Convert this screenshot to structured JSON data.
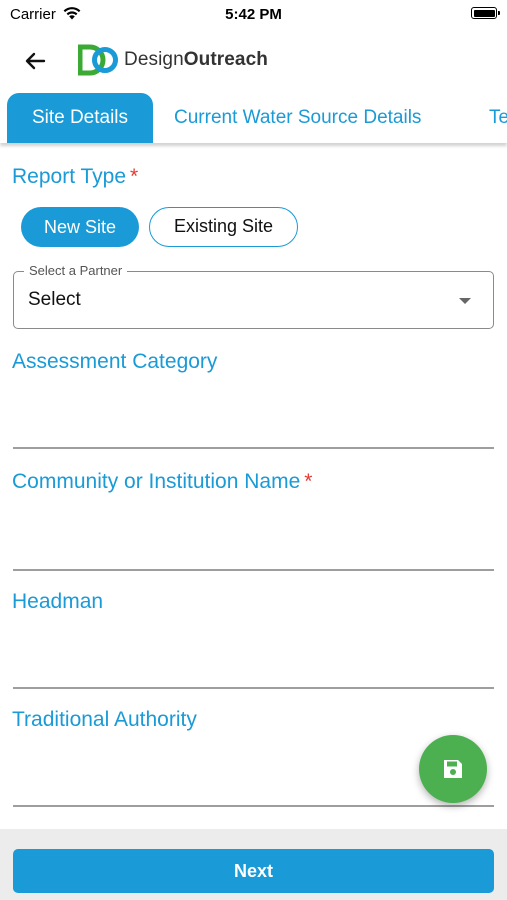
{
  "status_bar": {
    "carrier": "Carrier",
    "time": "5:42 PM"
  },
  "app_bar": {
    "brand_prefix": "Design",
    "brand_suffix": "Outreach",
    "logo_letters": "DO"
  },
  "tabs": [
    {
      "label": "Site Details",
      "active": true
    },
    {
      "label": "Current Water Source Details",
      "active": false
    },
    {
      "label": "Te",
      "active": false
    }
  ],
  "form": {
    "report_type": {
      "label": "Report Type",
      "required_mark": "*",
      "options": [
        "New Site",
        "Existing Site"
      ],
      "selected": "New Site"
    },
    "partner": {
      "legend": "Select a Partner",
      "value": "Select"
    },
    "assessment_category": {
      "label": "Assessment Category",
      "value": ""
    },
    "community_name": {
      "label": "Community or Institution Name",
      "required_mark": "*",
      "value": ""
    },
    "headman": {
      "label": "Headman",
      "value": ""
    },
    "traditional_authority": {
      "label": "Traditional Authority",
      "value": ""
    }
  },
  "actions": {
    "next_label": "Next",
    "save_icon": "save-icon"
  },
  "colors": {
    "accent": "#1a9ad6",
    "required": "#e53935",
    "fab": "#4caf50",
    "logo_green": "#3aaa35",
    "logo_blue": "#1a9ad6"
  }
}
